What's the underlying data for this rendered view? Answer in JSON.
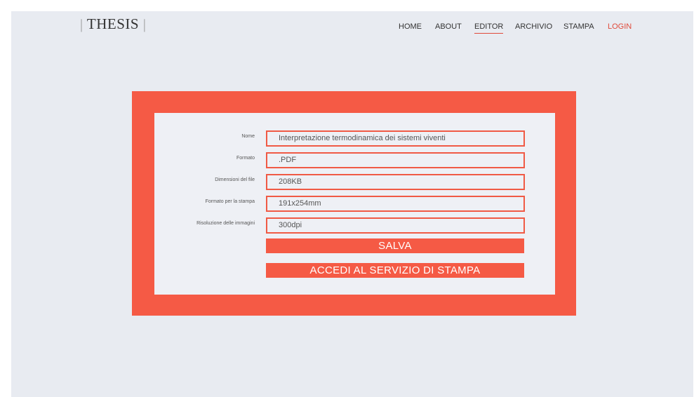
{
  "header": {
    "logo": "THESIS",
    "logo_bar": "|",
    "nav": [
      {
        "label": "HOME"
      },
      {
        "label": "ABOUT"
      },
      {
        "label": "EDITOR"
      },
      {
        "label": "ARCHIVIO"
      },
      {
        "label": "STAMPA"
      },
      {
        "label": "LOGIN"
      }
    ]
  },
  "form": {
    "fields": [
      {
        "label": "Nome",
        "value": "Interpretazione termodinamica dei sistemi viventi"
      },
      {
        "label": "Formato",
        "value": ".PDF"
      },
      {
        "label": "Dimensioni del file",
        "value": "208KB"
      },
      {
        "label": "Formato per la stampa",
        "value": "191x254mm"
      },
      {
        "label": "Risoluzione delle immagini",
        "value": "300dpi"
      }
    ],
    "save_label": "SALVA",
    "print_label": "ACCEDI AL SERVIZIO DI STAMPA"
  },
  "colors": {
    "accent": "#f55a45",
    "background": "#e8ebf1",
    "card": "#eef0f5"
  }
}
